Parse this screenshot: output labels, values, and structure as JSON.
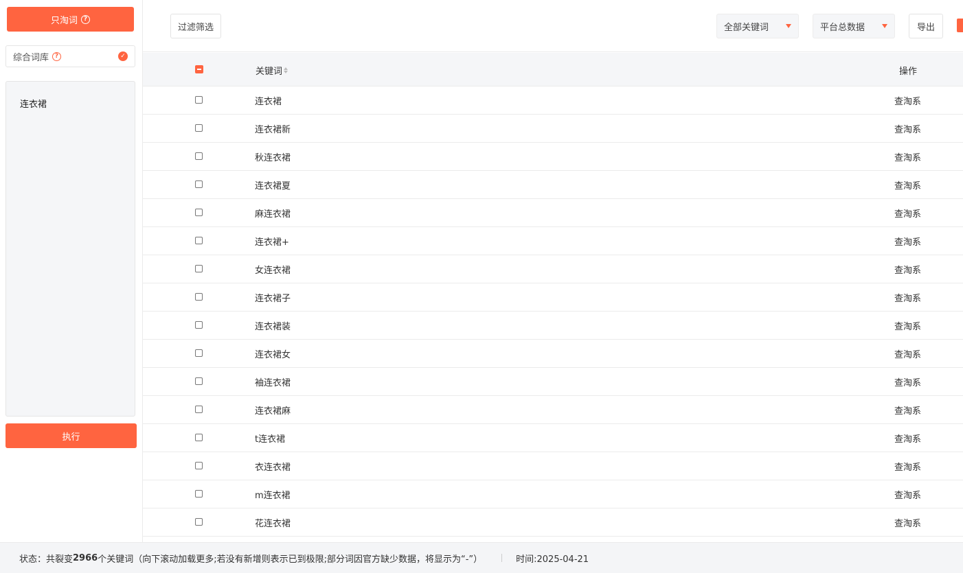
{
  "sidebar": {
    "only_taobao_label": "只淘词",
    "library_label": "综合词库",
    "input_value": "连衣裙",
    "execute_label": "执行"
  },
  "toolbar": {
    "filter_label": "过滤筛选",
    "keyword_select": "全部关键词",
    "platform_select": "平台总数据",
    "export_label": "导出"
  },
  "table": {
    "columns": {
      "keyword": "关键词",
      "action": "操作"
    },
    "rows": [
      {
        "keyword": "连衣裙",
        "action": "查淘系"
      },
      {
        "keyword": "连衣裙新",
        "action": "查淘系"
      },
      {
        "keyword": "秋连衣裙",
        "action": "查淘系"
      },
      {
        "keyword": "连衣裙夏",
        "action": "查淘系"
      },
      {
        "keyword": "麻连衣裙",
        "action": "查淘系"
      },
      {
        "keyword": "连衣裙+",
        "action": "查淘系"
      },
      {
        "keyword": "女连衣裙",
        "action": "查淘系"
      },
      {
        "keyword": "连衣裙子",
        "action": "查淘系"
      },
      {
        "keyword": "连衣裙装",
        "action": "查淘系"
      },
      {
        "keyword": "连衣裙女",
        "action": "查淘系"
      },
      {
        "keyword": "袖连衣裙",
        "action": "查淘系"
      },
      {
        "keyword": "连衣裙麻",
        "action": "查淘系"
      },
      {
        "keyword": "t连衣裙",
        "action": "查淘系"
      },
      {
        "keyword": "衣连衣裙",
        "action": "查淘系"
      },
      {
        "keyword": "m连衣裙",
        "action": "查淘系"
      },
      {
        "keyword": "花连衣裙",
        "action": "查淘系"
      }
    ]
  },
  "status": {
    "prefix": "状态：共裂变",
    "count": "2966",
    "suffix": "个关键词（向下滚动加载更多;若没有新增则表示已到极限;部分词因官方缺少数据，将显示为“-”）",
    "time": "时间:2025-04-21"
  },
  "colors": {
    "accent": "#ff6440"
  }
}
